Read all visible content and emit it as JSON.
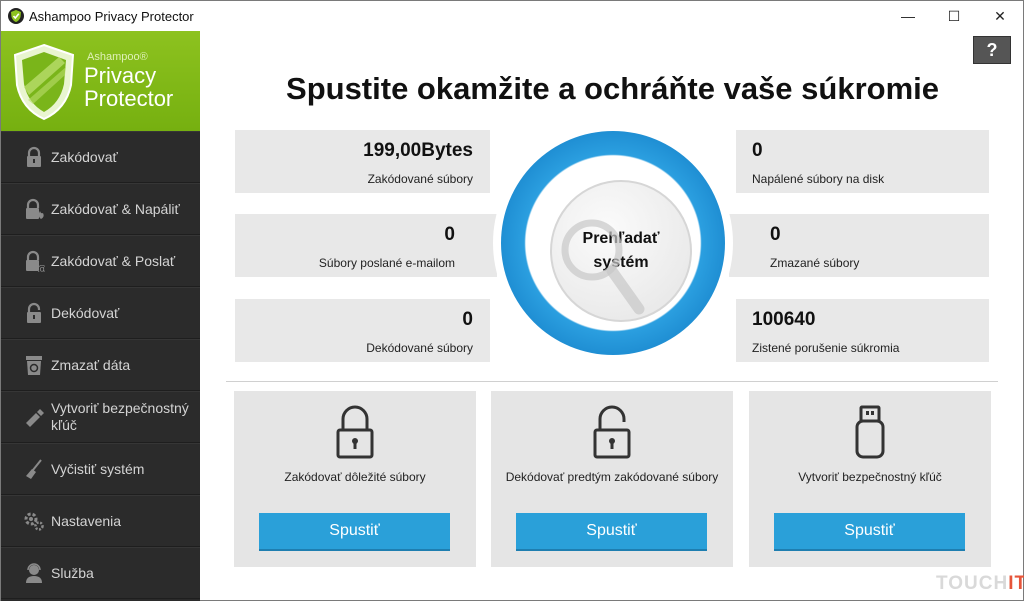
{
  "window": {
    "title": "Ashampoo Privacy Protector",
    "minimize_glyph": "—",
    "maximize_glyph": "☐",
    "close_glyph": "✕"
  },
  "logo": {
    "brand": "Ashampoo®",
    "line1": "Privacy",
    "line2": "Protector"
  },
  "sidebar": {
    "items": [
      {
        "label": "Zakódovať",
        "icon": "lock-icon"
      },
      {
        "label": "Zakódovať & Napáliť",
        "icon": "lock-fire-icon"
      },
      {
        "label": "Zakódovať & Poslať",
        "icon": "lock-mail-icon"
      },
      {
        "label": "Dekódovať",
        "icon": "unlock-icon"
      },
      {
        "label": "Zmazať dáta",
        "icon": "shredder-icon"
      },
      {
        "label": "Vytvoriť bezpečnostný kľúč",
        "icon": "usb-key-icon"
      },
      {
        "label": "Vyčistiť systém",
        "icon": "broom-icon"
      },
      {
        "label": "Nastavenia",
        "icon": "gear-icon"
      },
      {
        "label": "Služba",
        "icon": "support-icon"
      }
    ]
  },
  "help_label": "?",
  "headline": "Spustite okamžite a ochráňte vaše súkromie",
  "stats": {
    "encoded": {
      "value": "199,00Bytes",
      "label": "Zakódované súbory"
    },
    "burned": {
      "value": "0",
      "label": "Napálené súbory na disk"
    },
    "mailed": {
      "value": "0",
      "label": "Súbory poslané e-mailom"
    },
    "deleted": {
      "value": "0",
      "label": "Zmazané súbory"
    },
    "decoded": {
      "value": "0",
      "label": "Dekódované súbory"
    },
    "violations": {
      "value": "100640",
      "label": "Zistené porušenie súkromia"
    }
  },
  "scan_button": {
    "line1": "Prehľadať",
    "line2": "systém"
  },
  "cards": [
    {
      "text": "Zakódovať dôležité súbory",
      "button": "Spustiť",
      "icon": "lock-icon"
    },
    {
      "text": "Dekódovať predtým zakódované súbory",
      "button": "Spustiť",
      "icon": "unlock-icon"
    },
    {
      "text": "Vytvoriť bezpečnostný kľúč",
      "button": "Spustiť",
      "icon": "usb-key-icon"
    }
  ],
  "watermark": {
    "part1": "TOUCH",
    "part2": "IT"
  },
  "colors": {
    "accent_green": "#8dc21f",
    "accent_blue": "#2aa0d9",
    "sidebar_bg": "#2b2b2b"
  }
}
